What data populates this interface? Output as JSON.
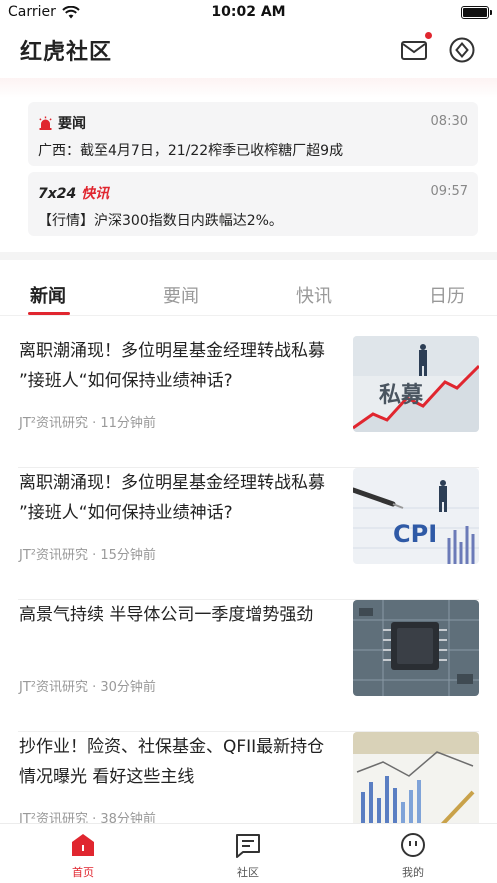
{
  "status_bar": {
    "carrier": "Carrier",
    "time": "10:02 AM"
  },
  "header": {
    "title": "红虎社区",
    "mail_icon": "mail-icon",
    "compass_icon": "compass-icon",
    "accent": "#e0262f"
  },
  "flash": [
    {
      "label": "要闻",
      "time": "08:30",
      "text": "广西：截至4月7日，21/22榨季已收榨糖厂超9成"
    },
    {
      "label_prefix": "7x24",
      "label_suffix": "快讯",
      "time": "09:57",
      "text": "【行情】沪深300指数日内跌幅达2%。"
    }
  ],
  "tabs": [
    {
      "label": "新闻",
      "active": true
    },
    {
      "label": "要闻",
      "active": false
    },
    {
      "label": "快讯",
      "active": false
    },
    {
      "label": "日历",
      "active": false
    }
  ],
  "news": [
    {
      "title": "离职潮涌现！多位明星基金经理转战私募 ”接班人“如何保持业绩神话?",
      "meta": "JT²资讯研究 · 11分钟前",
      "thumb_text": "私募"
    },
    {
      "title": "离职潮涌现！多位明星基金经理转战私募 ”接班人“如何保持业绩神话?",
      "meta": "JT²资讯研究 · 15分钟前",
      "thumb_text": "CPI"
    },
    {
      "title": "高景气持续 半导体公司一季度增势强劲",
      "meta": "JT²资讯研究 · 30分钟前",
      "thumb_text": ""
    },
    {
      "title": "抄作业！险资、社保基金、QFII最新持仓情况曝光  看好这些主线",
      "meta": "JT²资讯研究 · 38分钟前",
      "thumb_text": ""
    }
  ],
  "bottom_nav": [
    {
      "label": "首页",
      "icon": "home-icon",
      "active": true
    },
    {
      "label": "社区",
      "icon": "community-icon",
      "active": false
    },
    {
      "label": "我的",
      "icon": "profile-icon",
      "active": false
    }
  ]
}
